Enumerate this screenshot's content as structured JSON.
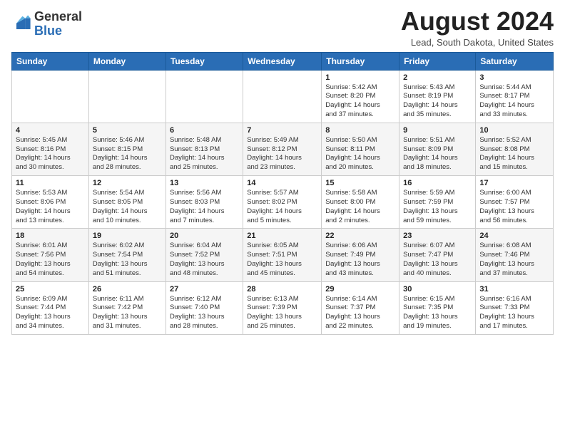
{
  "header": {
    "logo_line1": "General",
    "logo_line2": "Blue",
    "month_title": "August 2024",
    "location": "Lead, South Dakota, United States"
  },
  "weekdays": [
    "Sunday",
    "Monday",
    "Tuesday",
    "Wednesday",
    "Thursday",
    "Friday",
    "Saturday"
  ],
  "weeks": [
    [
      {
        "num": "",
        "info": ""
      },
      {
        "num": "",
        "info": ""
      },
      {
        "num": "",
        "info": ""
      },
      {
        "num": "",
        "info": ""
      },
      {
        "num": "1",
        "info": "Sunrise: 5:42 AM\nSunset: 8:20 PM\nDaylight: 14 hours\nand 37 minutes."
      },
      {
        "num": "2",
        "info": "Sunrise: 5:43 AM\nSunset: 8:19 PM\nDaylight: 14 hours\nand 35 minutes."
      },
      {
        "num": "3",
        "info": "Sunrise: 5:44 AM\nSunset: 8:17 PM\nDaylight: 14 hours\nand 33 minutes."
      }
    ],
    [
      {
        "num": "4",
        "info": "Sunrise: 5:45 AM\nSunset: 8:16 PM\nDaylight: 14 hours\nand 30 minutes."
      },
      {
        "num": "5",
        "info": "Sunrise: 5:46 AM\nSunset: 8:15 PM\nDaylight: 14 hours\nand 28 minutes."
      },
      {
        "num": "6",
        "info": "Sunrise: 5:48 AM\nSunset: 8:13 PM\nDaylight: 14 hours\nand 25 minutes."
      },
      {
        "num": "7",
        "info": "Sunrise: 5:49 AM\nSunset: 8:12 PM\nDaylight: 14 hours\nand 23 minutes."
      },
      {
        "num": "8",
        "info": "Sunrise: 5:50 AM\nSunset: 8:11 PM\nDaylight: 14 hours\nand 20 minutes."
      },
      {
        "num": "9",
        "info": "Sunrise: 5:51 AM\nSunset: 8:09 PM\nDaylight: 14 hours\nand 18 minutes."
      },
      {
        "num": "10",
        "info": "Sunrise: 5:52 AM\nSunset: 8:08 PM\nDaylight: 14 hours\nand 15 minutes."
      }
    ],
    [
      {
        "num": "11",
        "info": "Sunrise: 5:53 AM\nSunset: 8:06 PM\nDaylight: 14 hours\nand 13 minutes."
      },
      {
        "num": "12",
        "info": "Sunrise: 5:54 AM\nSunset: 8:05 PM\nDaylight: 14 hours\nand 10 minutes."
      },
      {
        "num": "13",
        "info": "Sunrise: 5:56 AM\nSunset: 8:03 PM\nDaylight: 14 hours\nand 7 minutes."
      },
      {
        "num": "14",
        "info": "Sunrise: 5:57 AM\nSunset: 8:02 PM\nDaylight: 14 hours\nand 5 minutes."
      },
      {
        "num": "15",
        "info": "Sunrise: 5:58 AM\nSunset: 8:00 PM\nDaylight: 14 hours\nand 2 minutes."
      },
      {
        "num": "16",
        "info": "Sunrise: 5:59 AM\nSunset: 7:59 PM\nDaylight: 13 hours\nand 59 minutes."
      },
      {
        "num": "17",
        "info": "Sunrise: 6:00 AM\nSunset: 7:57 PM\nDaylight: 13 hours\nand 56 minutes."
      }
    ],
    [
      {
        "num": "18",
        "info": "Sunrise: 6:01 AM\nSunset: 7:56 PM\nDaylight: 13 hours\nand 54 minutes."
      },
      {
        "num": "19",
        "info": "Sunrise: 6:02 AM\nSunset: 7:54 PM\nDaylight: 13 hours\nand 51 minutes."
      },
      {
        "num": "20",
        "info": "Sunrise: 6:04 AM\nSunset: 7:52 PM\nDaylight: 13 hours\nand 48 minutes."
      },
      {
        "num": "21",
        "info": "Sunrise: 6:05 AM\nSunset: 7:51 PM\nDaylight: 13 hours\nand 45 minutes."
      },
      {
        "num": "22",
        "info": "Sunrise: 6:06 AM\nSunset: 7:49 PM\nDaylight: 13 hours\nand 43 minutes."
      },
      {
        "num": "23",
        "info": "Sunrise: 6:07 AM\nSunset: 7:47 PM\nDaylight: 13 hours\nand 40 minutes."
      },
      {
        "num": "24",
        "info": "Sunrise: 6:08 AM\nSunset: 7:46 PM\nDaylight: 13 hours\nand 37 minutes."
      }
    ],
    [
      {
        "num": "25",
        "info": "Sunrise: 6:09 AM\nSunset: 7:44 PM\nDaylight: 13 hours\nand 34 minutes."
      },
      {
        "num": "26",
        "info": "Sunrise: 6:11 AM\nSunset: 7:42 PM\nDaylight: 13 hours\nand 31 minutes."
      },
      {
        "num": "27",
        "info": "Sunrise: 6:12 AM\nSunset: 7:40 PM\nDaylight: 13 hours\nand 28 minutes."
      },
      {
        "num": "28",
        "info": "Sunrise: 6:13 AM\nSunset: 7:39 PM\nDaylight: 13 hours\nand 25 minutes."
      },
      {
        "num": "29",
        "info": "Sunrise: 6:14 AM\nSunset: 7:37 PM\nDaylight: 13 hours\nand 22 minutes."
      },
      {
        "num": "30",
        "info": "Sunrise: 6:15 AM\nSunset: 7:35 PM\nDaylight: 13 hours\nand 19 minutes."
      },
      {
        "num": "31",
        "info": "Sunrise: 6:16 AM\nSunset: 7:33 PM\nDaylight: 13 hours\nand 17 minutes."
      }
    ]
  ]
}
